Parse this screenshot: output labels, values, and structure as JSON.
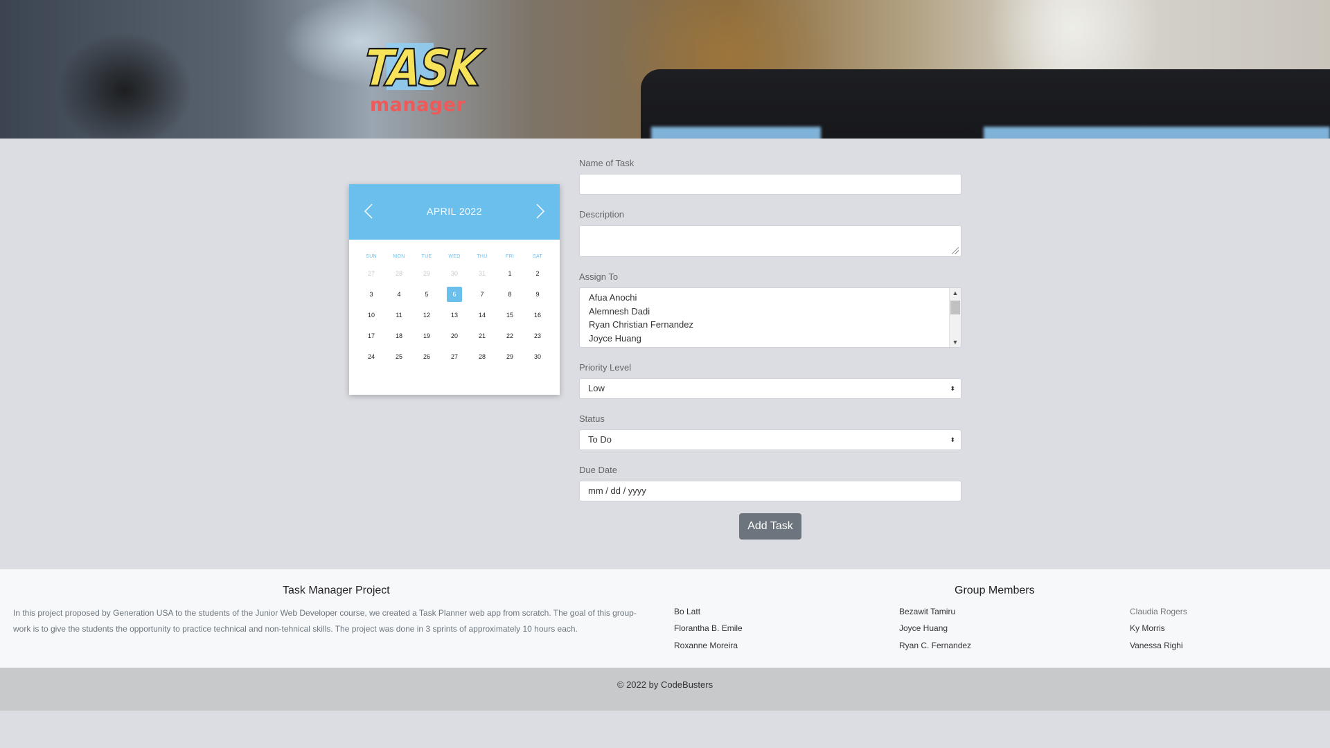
{
  "logo": {
    "line1": "TASK",
    "line2": "manager"
  },
  "calendar": {
    "month_label": "APRIL  2022",
    "weekdays": [
      "SUN",
      "MON",
      "TUE",
      "WED",
      "THU",
      "FRI",
      "SAT"
    ],
    "days": [
      {
        "d": "27",
        "muted": true
      },
      {
        "d": "28",
        "muted": true
      },
      {
        "d": "29",
        "muted": true
      },
      {
        "d": "30",
        "muted": true
      },
      {
        "d": "31",
        "muted": true
      },
      {
        "d": "1"
      },
      {
        "d": "2"
      },
      {
        "d": "3"
      },
      {
        "d": "4"
      },
      {
        "d": "5"
      },
      {
        "d": "6",
        "today": true
      },
      {
        "d": "7"
      },
      {
        "d": "8"
      },
      {
        "d": "9"
      },
      {
        "d": "10"
      },
      {
        "d": "11"
      },
      {
        "d": "12"
      },
      {
        "d": "13"
      },
      {
        "d": "14"
      },
      {
        "d": "15"
      },
      {
        "d": "16"
      },
      {
        "d": "17"
      },
      {
        "d": "18"
      },
      {
        "d": "19"
      },
      {
        "d": "20"
      },
      {
        "d": "21"
      },
      {
        "d": "22"
      },
      {
        "d": "23"
      },
      {
        "d": "24"
      },
      {
        "d": "25"
      },
      {
        "d": "26"
      },
      {
        "d": "27"
      },
      {
        "d": "28"
      },
      {
        "d": "29"
      },
      {
        "d": "30"
      }
    ],
    "accent_color": "#6bbfec"
  },
  "form": {
    "name_label": "Name of Task",
    "name_value": "",
    "description_label": "Description",
    "description_value": "",
    "assign_label": "Assign To",
    "assign_options": [
      "Afua Anochi",
      "Alemnesh Dadi",
      "Ryan Christian Fernandez",
      "Joyce Huang"
    ],
    "priority_label": "Priority Level",
    "priority_value": "Low",
    "status_label": "Status",
    "status_value": "To Do",
    "due_label": "Due Date",
    "due_placeholder": "mm / dd / yyyy",
    "submit_label": "Add Task"
  },
  "footer": {
    "project_title": "Task Manager Project",
    "project_text": "In this project proposed by Generation USA to the students of the Junior Web Developer course, we created a Task Planner web app from scratch. The goal of this group-work is to give the students the opportunity to practice technical and non-tehnical skills. The project was done in 3 sprints of approximately 10 hours each.",
    "members_title": "Group Members",
    "members_col1": [
      "Bo Latt",
      "Florantha B. Emile",
      "Roxanne Moreira"
    ],
    "members_col2": [
      "Bezawit Tamiru",
      "Joyce Huang",
      "Ryan C. Fernandez"
    ],
    "members_col3": [
      "Claudia Rogers",
      "Ky Morris",
      "Vanessa Righi"
    ],
    "copyright": "© 2022 by CodeBusters"
  },
  "colors": {
    "page_bg": "#dcdde3",
    "button_bg": "#6c757d",
    "logo_yellow": "#f6e35a",
    "logo_red": "#ee5a5a"
  }
}
